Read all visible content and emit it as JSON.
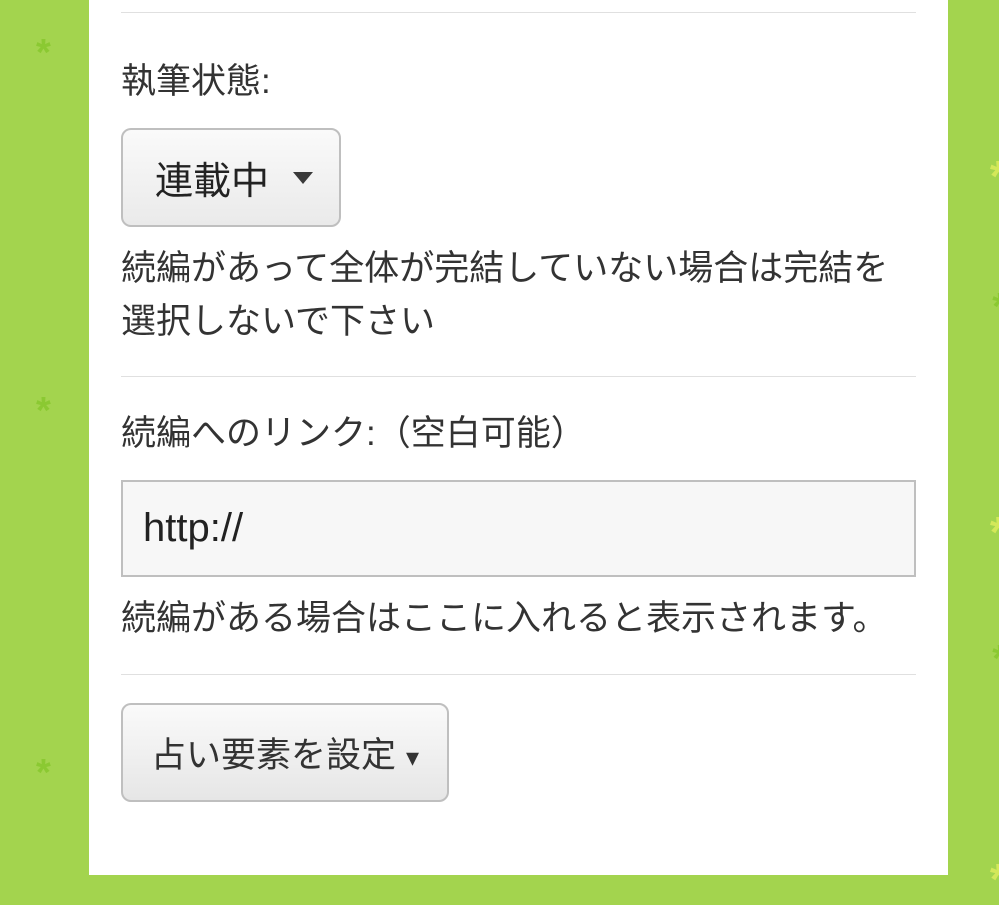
{
  "form": {
    "status": {
      "label": "執筆状態:",
      "selected": "連載中",
      "help": "続編があって全体が完結していない場合は完結を選択しないで下さい"
    },
    "sequel_link": {
      "label": "続編へのリンク:（空白可能）",
      "value": "http://",
      "help": "続編がある場合はここに入れると表示されます。"
    },
    "fortune_button": {
      "label": "占い要素を設定",
      "caret": "▾"
    }
  }
}
